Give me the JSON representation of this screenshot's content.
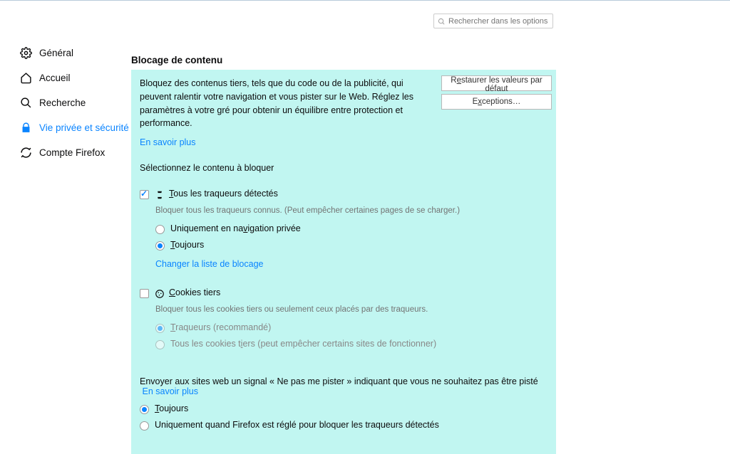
{
  "search": {
    "placeholder": "Rechercher dans les options"
  },
  "sidebar": {
    "items": [
      {
        "label": "Général"
      },
      {
        "label": "Accueil"
      },
      {
        "label": "Recherche"
      },
      {
        "label": "Vie privée et sécurité"
      },
      {
        "label": "Compte Firefox"
      }
    ]
  },
  "section": {
    "title": "Blocage de contenu",
    "description": "Bloquez des contenus tiers, tels que du code ou de la publicité, qui peuvent ralentir votre navigation et vous pister sur le Web. Réglez les paramètres à votre gré pour obtenir un équilibre entre protection et performance.",
    "learn_more": "En savoir plus",
    "select_label": "Sélectionnez le contenu à bloquer",
    "buttons": {
      "restore_pre": "R",
      "restore_u": "e",
      "restore_post": "staurer les valeurs par défaut",
      "exc_pre": "E",
      "exc_u": "x",
      "exc_post": "ceptions…"
    },
    "trackers": {
      "label_pre": "T",
      "label_post": "ous les traqueurs détectés",
      "hint": "Bloquer tous les traqueurs connus. (Peut empêcher certaines pages de se charger.)",
      "opt_priv_pre": "Uniquement en na",
      "opt_priv_u": "v",
      "opt_priv_post": "igation privée",
      "opt_always_pre": "T",
      "opt_always_post": "oujours",
      "change_list": "Changer la liste de blocage"
    },
    "cookies": {
      "label_pre": "C",
      "label_post": "ookies tiers",
      "hint": "Bloquer tous les cookies tiers ou seulement ceux placés par des traqueurs.",
      "opt1_pre": "T",
      "opt1_post": "raqueurs (recommandé)",
      "opt2_pre": "Tous les cookies t",
      "opt2_u": "i",
      "opt2_post": "ers (peut empêcher certains sites de fonctionner)"
    },
    "dnt": {
      "text": "Envoyer aux sites web un signal « Ne pas me pister » indiquant que vous ne souhaitez pas être pisté",
      "learn_more": "En savoir plus",
      "opt1_pre": "T",
      "opt1_post": "oujours",
      "opt2": "Uniquement quand Firefox est réglé pour bloquer les traqueurs détectés"
    }
  }
}
